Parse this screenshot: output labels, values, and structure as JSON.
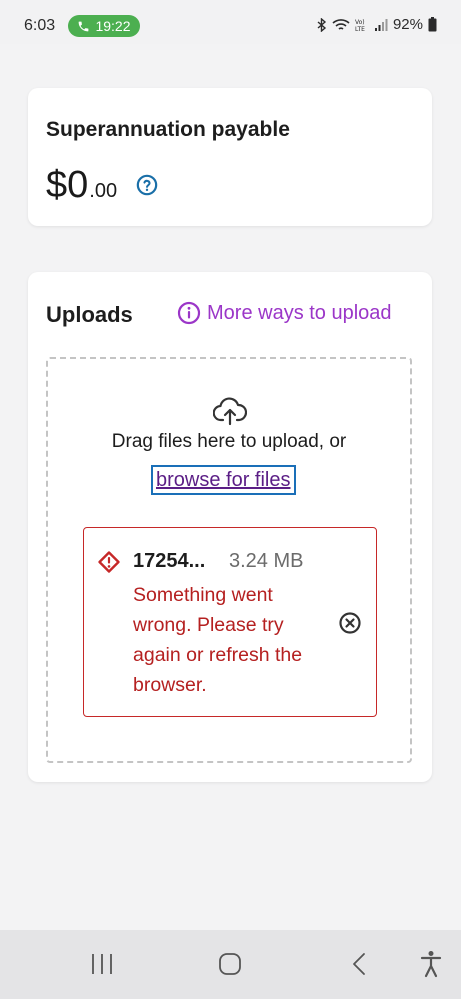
{
  "status_bar": {
    "time": "6:03",
    "call_duration": "19:22",
    "battery": "92%",
    "icons": [
      "bluetooth-icon",
      "wifi-icon",
      "volte-icon",
      "signal-icon",
      "battery-icon"
    ]
  },
  "super_card": {
    "title": "Superannuation payable",
    "amount_dollars": "$0",
    "amount_cents": ".00",
    "help_icon": "question-circle-icon"
  },
  "uploads": {
    "title": "Uploads",
    "more_ways_label": "More ways to upload",
    "drag_text": "Drag files here to upload, or",
    "browse_label": "browse for files",
    "file": {
      "name": "17254...",
      "size": "3.24 MB",
      "error": "Something went wrong. Please try again or refresh the browser."
    }
  },
  "colors": {
    "accent_purple": "#9b36c8",
    "error_red": "#c62828",
    "link_blue": "#1a6fb8",
    "call_green": "#4caf50"
  },
  "nav_bar": {
    "icons": [
      "recents-icon",
      "home-icon",
      "back-icon",
      "accessibility-icon"
    ]
  }
}
